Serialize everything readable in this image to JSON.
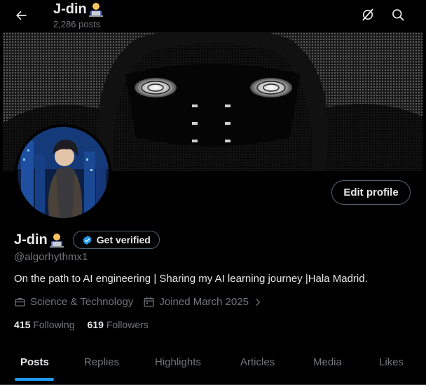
{
  "header": {
    "back_icon": "arrow-left-icon",
    "name": "J-din",
    "name_emoji": "technologist-emoji",
    "post_count": "2,286 posts",
    "grok_icon": "grok-icon",
    "search_icon": "search-icon"
  },
  "profile": {
    "name": "J-din",
    "get_verified_label": "Get verified",
    "handle": "@algorhythmx1",
    "bio": "On the path to AI engineering | Sharing my AI learning journey |Hala Madrid.",
    "category": "Science & Technology",
    "joined": "Joined March 2025",
    "edit_profile_label": "Edit profile",
    "following_count": "415",
    "following_label": "Following",
    "followers_count": "619",
    "followers_label": "Followers"
  },
  "tabs": [
    {
      "label": "Posts",
      "active": true
    },
    {
      "label": "Replies",
      "active": false
    },
    {
      "label": "Highlights",
      "active": false
    },
    {
      "label": "Articles",
      "active": false
    },
    {
      "label": "Media",
      "active": false
    },
    {
      "label": "Likes",
      "active": false
    }
  ],
  "colors": {
    "background": "#000000",
    "accent": "#1d9bf0",
    "text_primary": "#e7e9ea",
    "text_secondary": "#71767b",
    "border": "#536471"
  }
}
